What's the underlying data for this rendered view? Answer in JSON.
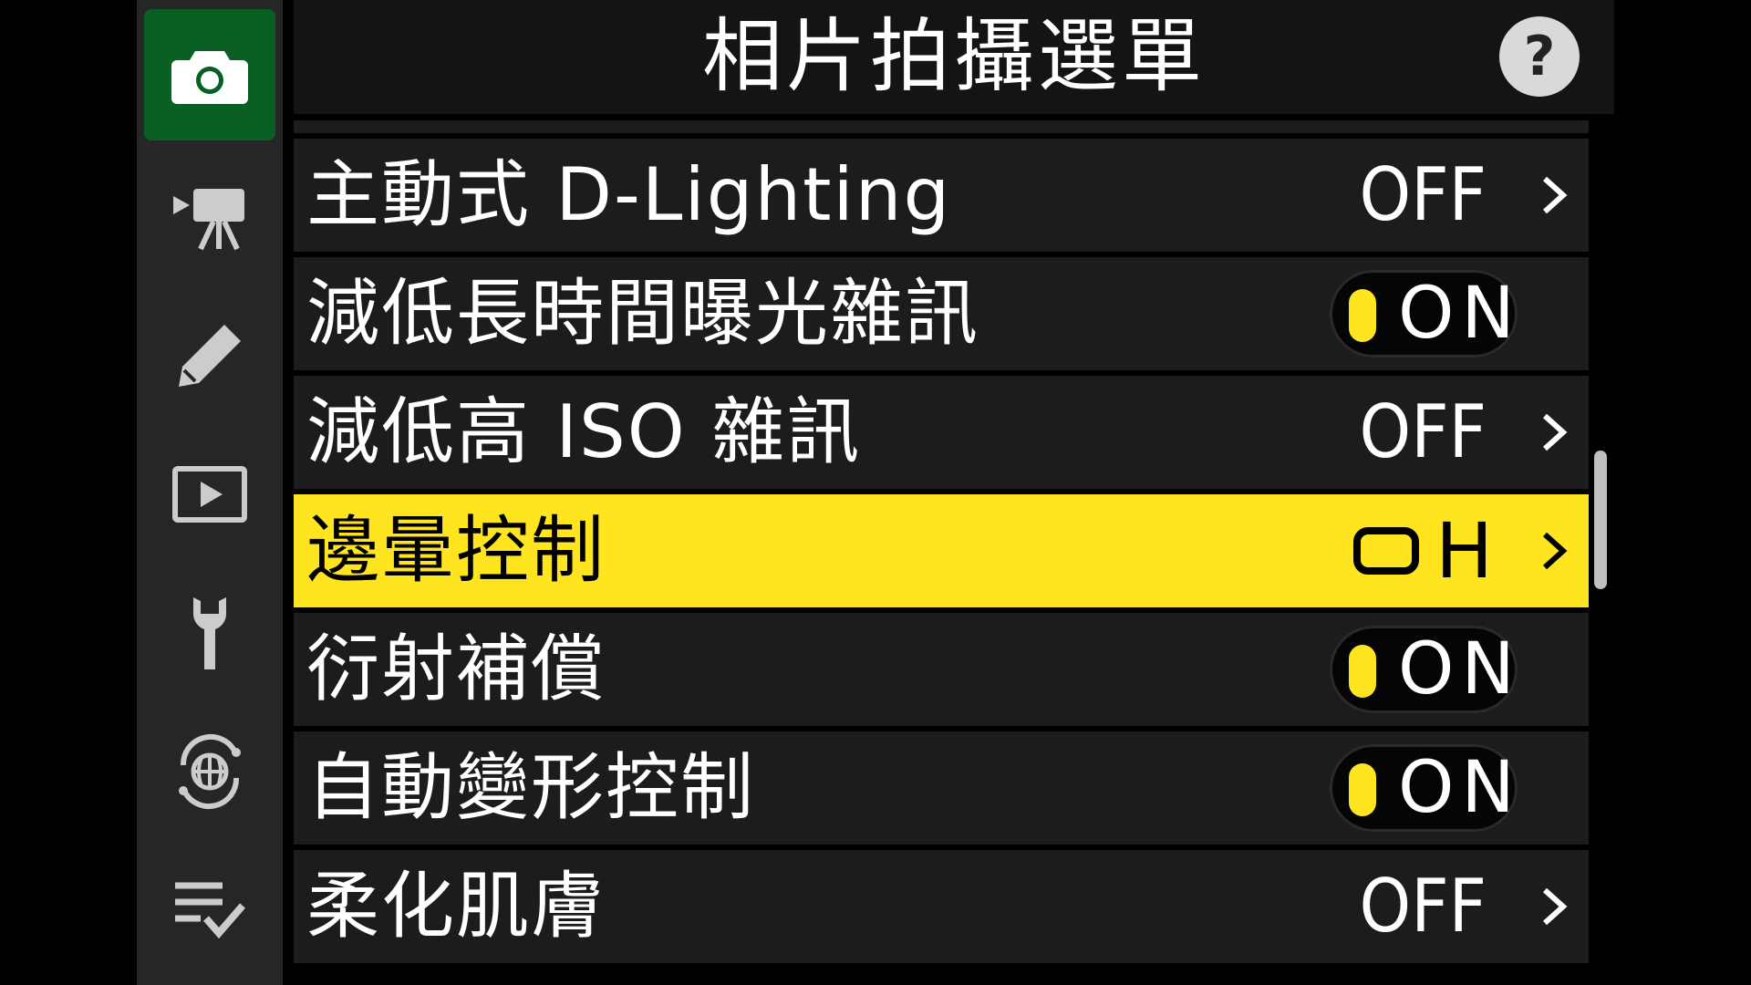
{
  "header": {
    "title": "相片拍攝選單",
    "help_label": "?"
  },
  "rail": {
    "items": [
      {
        "icon": "camera-icon",
        "active": true
      },
      {
        "icon": "movie-camera-icon",
        "active": false
      },
      {
        "icon": "pencil-icon",
        "active": false
      },
      {
        "icon": "playback-icon",
        "active": false
      },
      {
        "icon": "wrench-icon",
        "active": false
      },
      {
        "icon": "network-globe-icon",
        "active": false
      },
      {
        "icon": "my-menu-icon",
        "active": false
      }
    ]
  },
  "menu": {
    "items": [
      {
        "label": "主動式 D-Lighting",
        "value": "OFF"
      },
      {
        "label": "減低長時間曝光雜訊",
        "value": "ON"
      },
      {
        "label": "減低高 ISO 雜訊",
        "value": "OFF"
      },
      {
        "label": "邊暈控制",
        "value": "H"
      },
      {
        "label": "衍射補償",
        "value": "ON"
      },
      {
        "label": "自動變形控制",
        "value": "ON"
      },
      {
        "label": "柔化肌膚",
        "value": "OFF"
      }
    ],
    "selected_index": 3
  },
  "colors": {
    "highlight": "#ffe51f",
    "active_tab": "#0a5f25",
    "row_bg": "#1c1c1c"
  }
}
